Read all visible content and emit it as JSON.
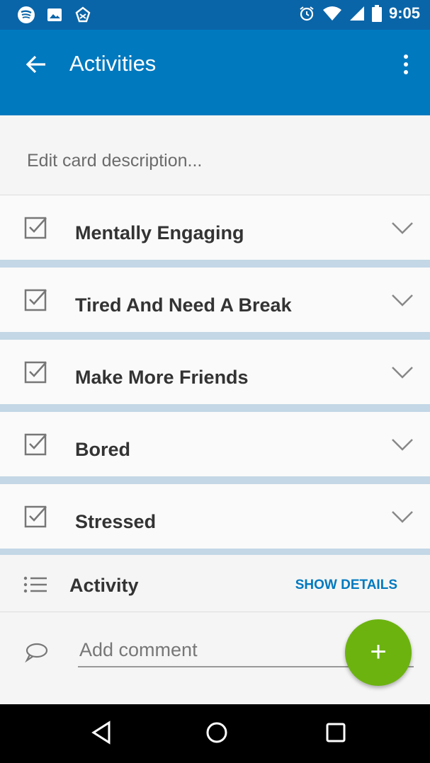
{
  "status_bar": {
    "time": "9:05",
    "left_icons": [
      "spotify-icon",
      "image-icon",
      "wireless-sync-icon"
    ],
    "right_icons": [
      "alarm-icon",
      "wifi-icon",
      "signal-icon",
      "battery-icon"
    ]
  },
  "app_bar": {
    "title": "Activities",
    "color": "#0079bf"
  },
  "description": {
    "placeholder": "Edit card description..."
  },
  "checklist": [
    {
      "label": "Mentally Engaging",
      "icon": "checkbox-icon"
    },
    {
      "label": "Tired And Need A Break",
      "icon": "checkbox-icon"
    },
    {
      "label": "Make More Friends",
      "icon": "checkbox-icon"
    },
    {
      "label": "Bored",
      "icon": "checkbox-icon"
    },
    {
      "label": "Stressed",
      "icon": "checkbox-icon"
    }
  ],
  "activity": {
    "label": "Activity",
    "show_details": "SHOW DETAILS"
  },
  "comment": {
    "placeholder": "Add comment"
  },
  "fab": {
    "symbol": "+",
    "color": "#6cb310"
  },
  "nav": [
    "back-nav-icon",
    "home-nav-icon",
    "recents-nav-icon"
  ]
}
